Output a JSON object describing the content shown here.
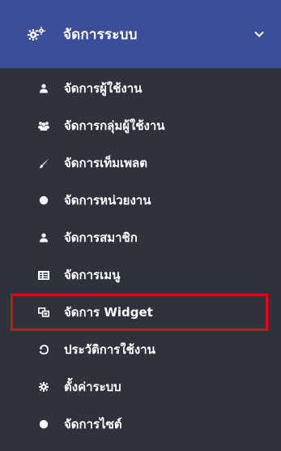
{
  "menu_group": {
    "title": "จัดการระบบ",
    "icon": "cogs-icon",
    "expand_icon": "chevron-down-icon",
    "header_color": "#3b4e97",
    "panel_color": "#2e333b",
    "highlight_color": "#e30613"
  },
  "items": [
    {
      "label": "จัดการผู้ใช้งาน",
      "icon": "user-icon"
    },
    {
      "label": "จัดการกลุ่มผู้ใช้งาน",
      "icon": "users-group-icon"
    },
    {
      "label": "จัดการเท็มเพลต",
      "icon": "brush-icon"
    },
    {
      "label": "จัดการหน่วยงาน",
      "icon": "circle-icon"
    },
    {
      "label": "จัดการสมาชิก",
      "icon": "user-icon"
    },
    {
      "label": "จัดการเมนู",
      "icon": "menu-list-icon"
    },
    {
      "label": "จัดการ Widget",
      "icon": "widget-icon",
      "highlighted": true
    },
    {
      "label": "ประวัติการใช้งาน",
      "icon": "history-icon"
    },
    {
      "label": "ตั้งค่าระบบ",
      "icon": "gear-icon"
    },
    {
      "label": "จัดการไซต์",
      "icon": "circle-icon"
    }
  ]
}
